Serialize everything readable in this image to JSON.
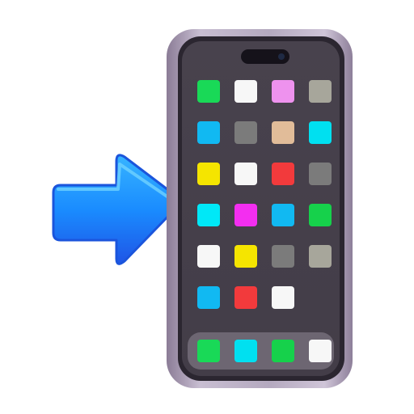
{
  "colors": {
    "arrow_main": "#1a8cff",
    "arrow_dark": "#1e56e8",
    "phone_frame": "#b4a9bf",
    "screen": "#454049",
    "dock": "#6d6672"
  },
  "icons": {
    "arrow": "right-arrow-icon",
    "phone": "mobile-phone-icon"
  },
  "home_apps": [
    [
      "#19d957",
      "#f7f7f7",
      "#ee92ee",
      "#a7a69b"
    ],
    [
      "#11b9f2",
      "#7b7b7b",
      "#e1bc99",
      "#00e0f0"
    ],
    [
      "#f5e500",
      "#f7f7f7",
      "#f23a3c",
      "#7b7b7b"
    ],
    [
      "#00e8f7",
      "#f32ef0",
      "#11b9f2",
      "#16d14b"
    ],
    [
      "#f7f7f7",
      "#f5e500",
      "#7b7b7b",
      "#a7a69b"
    ],
    [
      "#11b9f2",
      "#f23a3c",
      "#f7f7f7"
    ]
  ],
  "dock_apps": [
    "#19d957",
    "#00e0f0",
    "#16d14b",
    "#f7f7f7"
  ]
}
